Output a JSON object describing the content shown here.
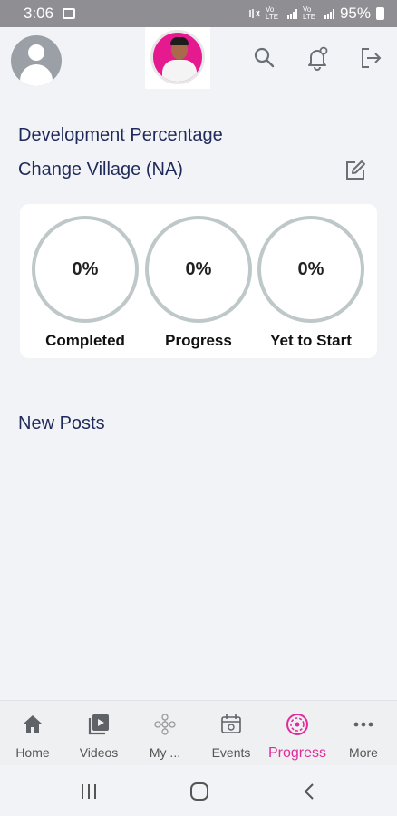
{
  "status_bar": {
    "time": "3:06",
    "network_1": "Vo LTE",
    "network_2": "Vo LTE",
    "battery": "95%"
  },
  "header": {
    "avatar_icon": "user-avatar-icon",
    "logo_icon": "profile-logo",
    "actions": [
      {
        "icon": "search-icon"
      },
      {
        "icon": "notification-bell-icon"
      },
      {
        "icon": "logout-icon"
      }
    ]
  },
  "main": {
    "development_title": "Development Percentage",
    "village_label": "Change Village (NA)",
    "edit_icon": "edit-icon",
    "stats": [
      {
        "value": "0%",
        "label": "Completed"
      },
      {
        "value": "0%",
        "label": "Progress"
      },
      {
        "value": "0%",
        "label": "Yet to Start"
      }
    ],
    "new_posts_title": "New Posts"
  },
  "bottom_nav": {
    "active_color": "#e02c9a",
    "items": [
      {
        "label": "Home",
        "icon": "home-icon"
      },
      {
        "label": "Videos",
        "icon": "video-library-icon"
      },
      {
        "label": "My ...",
        "icon": "network-icon"
      },
      {
        "label": "Events",
        "icon": "calendar-event-icon"
      },
      {
        "label": "Progress",
        "icon": "progress-icon",
        "active": true
      },
      {
        "label": "More",
        "icon": "more-dots-icon"
      }
    ]
  }
}
